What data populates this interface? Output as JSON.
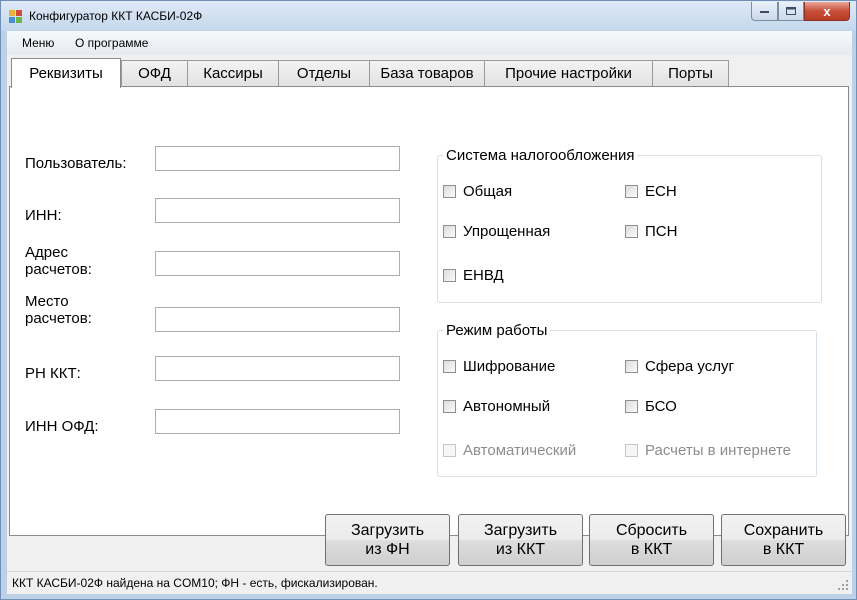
{
  "window": {
    "title": "Конфигуратор ККТ КАСБИ-02Ф",
    "close_glyph": "x"
  },
  "menu": {
    "items": [
      "Меню",
      "О программе"
    ]
  },
  "tabs": [
    {
      "label": "Реквизиты",
      "active": true
    },
    {
      "label": "ОФД",
      "active": false
    },
    {
      "label": "Кассиры",
      "active": false
    },
    {
      "label": "Отделы",
      "active": false
    },
    {
      "label": "База товаров",
      "active": false
    },
    {
      "label": "Прочие настройки",
      "active": false
    },
    {
      "label": "Порты",
      "active": false
    }
  ],
  "form": {
    "fields": [
      {
        "label": "Пользователь:",
        "value": ""
      },
      {
        "label": "ИНН:",
        "value": ""
      },
      {
        "label_lines": [
          "Адрес",
          "расчетов:"
        ],
        "value": ""
      },
      {
        "label_lines": [
          "Место",
          "расчетов:"
        ],
        "value": ""
      },
      {
        "label": "РН ККТ:",
        "value": ""
      },
      {
        "label": "ИНН ОФД:",
        "value": ""
      }
    ]
  },
  "tax_system": {
    "title": "Система налогообложения",
    "options": [
      {
        "label": "Общая",
        "checked": false
      },
      {
        "label": "ЕСН",
        "checked": false
      },
      {
        "label": "Упрощенная",
        "checked": false
      },
      {
        "label": "ПСН",
        "checked": false
      },
      {
        "label": "ЕНВД",
        "checked": false
      }
    ]
  },
  "work_mode": {
    "title": "Режим работы",
    "options": [
      {
        "label": "Шифрование",
        "checked": false,
        "enabled": true
      },
      {
        "label": "Сфера услуг",
        "checked": false,
        "enabled": true
      },
      {
        "label": "Автономный",
        "checked": false,
        "enabled": true
      },
      {
        "label": "БСО",
        "checked": false,
        "enabled": true
      },
      {
        "label": "Автоматический",
        "checked": false,
        "enabled": false
      },
      {
        "label": "Расчеты в интернете",
        "checked": false,
        "enabled": false
      }
    ]
  },
  "buttons": [
    {
      "line1": "Загрузить",
      "line2": "из ФН"
    },
    {
      "line1": "Загрузить",
      "line2": "из ККТ"
    },
    {
      "line1": "Сбросить",
      "line2": "в ККТ"
    },
    {
      "line1": "Сохранить",
      "line2": "в ККТ"
    }
  ],
  "status": {
    "text": "ККТ КАСБИ-02Ф найдена на COM10; ФН - есть, фискализирован."
  },
  "colors": {
    "frame": "#bcd0e6",
    "close_button": "#c7503a",
    "panel_bg": "#ffffff",
    "client_bg": "#f0f0f0"
  }
}
